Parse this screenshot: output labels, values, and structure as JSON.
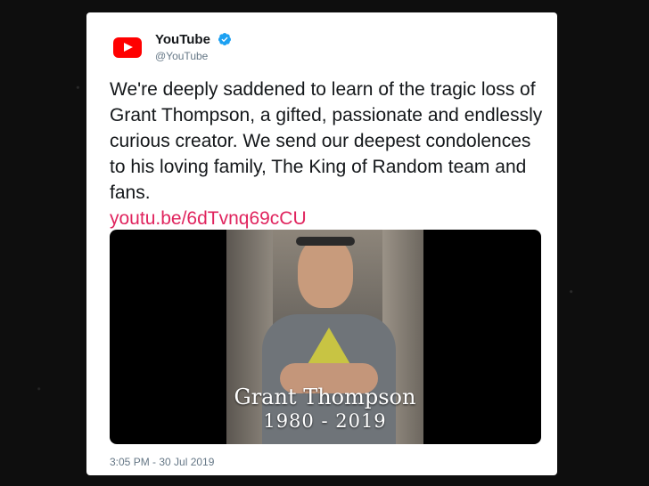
{
  "tweet": {
    "display_name": "YouTube",
    "handle": "@YouTube",
    "verified_icon": "verified-check-icon",
    "logo_icon": "youtube-logo-icon",
    "text": "We're deeply saddened to learn of the tragic loss of Grant Thompson, a gifted, passionate and endlessly curious creator. We send our deepest condolences to his loving family, The King of Random team and fans.",
    "link": "youtu.be/6dTvnq69cCU",
    "timestamp": "3:05 PM - 30 Jul 2019"
  },
  "media": {
    "caption_name": "Grant Thompson",
    "caption_years": "1980 - 2019"
  },
  "colors": {
    "brand_red": "#ff0000",
    "link_color": "#e0245e",
    "verified_blue": "#1da1f2",
    "text_primary": "#14171a",
    "text_secondary": "#657786"
  }
}
